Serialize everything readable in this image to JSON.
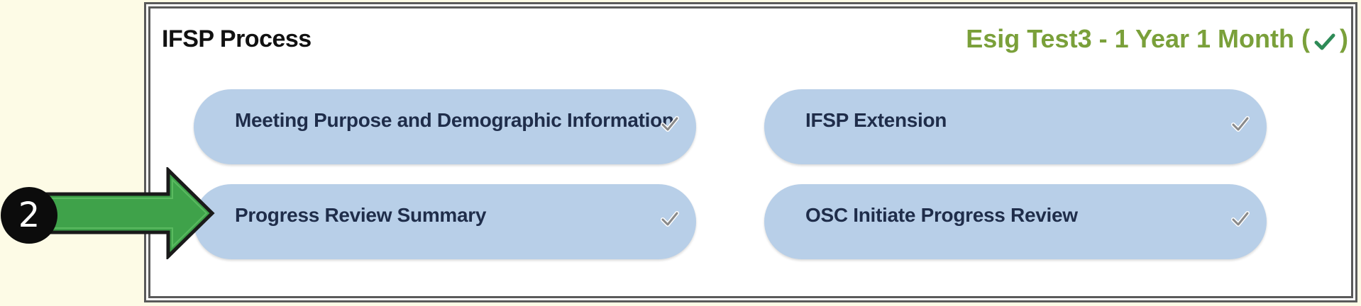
{
  "panel": {
    "title": "IFSP Process",
    "child_info": {
      "prefix": "Esig Test3 - 1 Year 1 Month (",
      "suffix": ")",
      "status_icon": "check-icon",
      "status_color": "#2e8b57"
    }
  },
  "tiles": [
    {
      "label": "Meeting Purpose and Demographic Information",
      "status_icon": "check-icon"
    },
    {
      "label": "IFSP Extension",
      "status_icon": "check-icon"
    },
    {
      "label": "Progress Review Summary",
      "status_icon": "check-icon"
    },
    {
      "label": "OSC Initiate Progress Review",
      "status_icon": "check-icon"
    }
  ],
  "callout": {
    "step_number": "2",
    "arrow_color": "#3fa24a",
    "badge_color": "#0c0c0c"
  },
  "colors": {
    "tile_background": "#b8cfe8",
    "tile_text": "#1f2d4a",
    "child_info_text": "#7aa03a",
    "page_background": "#fdfbe6"
  }
}
